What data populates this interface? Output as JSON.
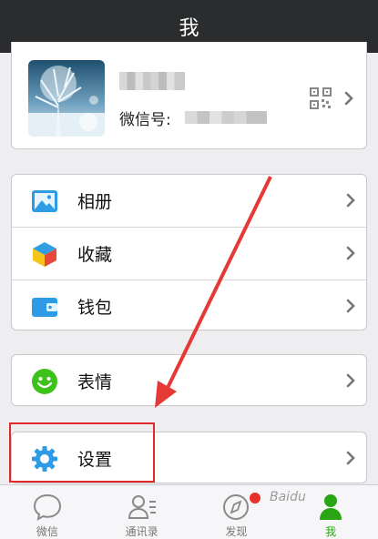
{
  "header": {
    "title": "我"
  },
  "profile": {
    "wechat_id_label": "微信号:"
  },
  "menu_group_1": [
    {
      "label": "相册",
      "icon": "photo-album-icon"
    },
    {
      "label": "收藏",
      "icon": "favorites-cube-icon"
    },
    {
      "label": "钱包",
      "icon": "wallet-icon"
    }
  ],
  "menu_group_2": [
    {
      "label": "表情",
      "icon": "smiley-icon"
    }
  ],
  "menu_group_3": [
    {
      "label": "设置",
      "icon": "gear-icon"
    }
  ],
  "tabbar": [
    {
      "label": "微信",
      "icon": "chat-bubble-icon",
      "active": false
    },
    {
      "label": "通讯录",
      "icon": "contacts-icon",
      "active": false
    },
    {
      "label": "发现",
      "icon": "compass-icon",
      "active": false,
      "badge": true
    },
    {
      "label": "我",
      "icon": "person-icon",
      "active": true
    }
  ],
  "colors": {
    "header_bg": "#2b2c2e",
    "active_green": "#2aa515",
    "annotation_red": "#e02a2a",
    "badge_red": "#e8302a"
  },
  "watermark": {
    "text": "Baidu"
  }
}
